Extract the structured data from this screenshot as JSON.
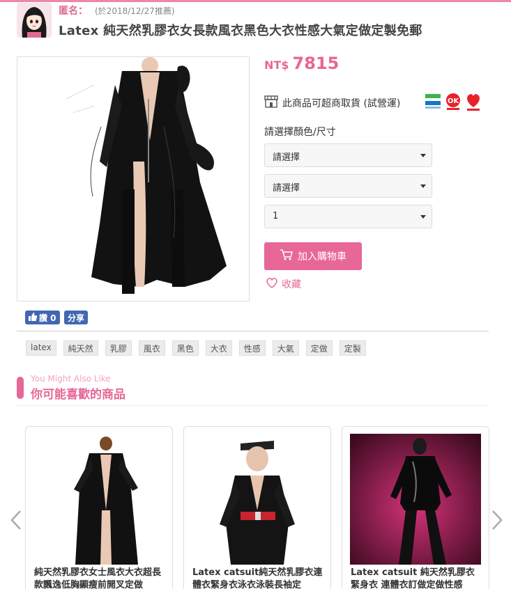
{
  "poster": {
    "name": "匿名：",
    "date": "(於2018/12/27推薦)"
  },
  "product": {
    "title": "Latex 純天然乳膠衣女長款風衣黑色大衣性感大氣定做定製免郵",
    "currency": "NT$",
    "price": "7815",
    "pickup_text": "此商品可超商取貨 (試營運)",
    "stores": [
      "FamilyMart",
      "OK mart",
      "萊爾富"
    ],
    "choose_label": "請選擇顏色/尺寸",
    "select_color": "請選擇",
    "select_size": "請選擇",
    "select_qty": "1",
    "cart_label": "加入購物車",
    "fav_label": "收藏"
  },
  "social": {
    "like_label": "讚 0",
    "share_label": "分享"
  },
  "tags": [
    "latex",
    "純天然",
    "乳膠",
    "風衣",
    "黑色",
    "大衣",
    "性感",
    "大氣",
    "定做",
    "定製"
  ],
  "recommend": {
    "title_en": "You Might Also Like",
    "title_zh": "你可能喜歡的商品",
    "items": [
      {
        "title": "純天然乳膠衣女士風衣大衣超長款飄逸低胸顯瘦前開叉定做"
      },
      {
        "title": "Latex catsuit純天然乳膠衣連體衣緊身衣泳衣泳裝長袖定",
        "watermark": "http://...hoyifu.taobao.com"
      },
      {
        "title": "Latex catsuit 純天然乳膠衣緊身衣 連體衣訂做定做性感"
      }
    ]
  },
  "colors": {
    "accent": "#e76796",
    "facebook": "#4267b2",
    "topbar": "#ec87a8"
  }
}
